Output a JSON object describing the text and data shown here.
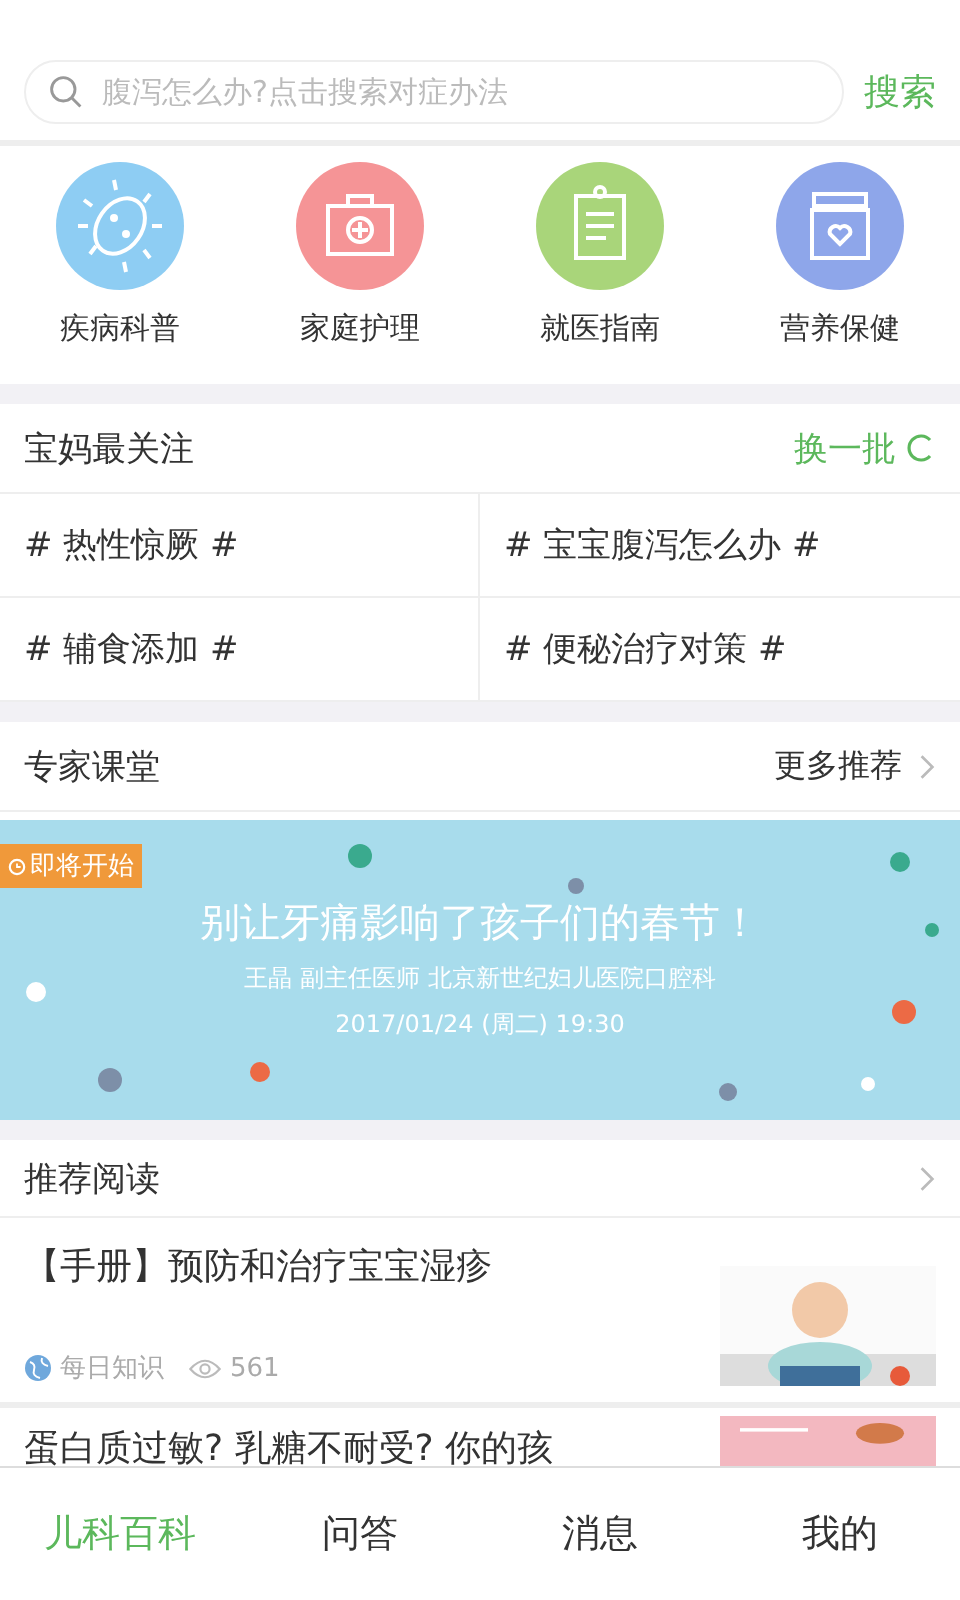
{
  "search": {
    "placeholder": "腹泻怎么办?点击搜索对症办法",
    "button": "搜索"
  },
  "categories": [
    {
      "label": "疾病科普",
      "kind": "germ",
      "color": "#8ecdf3"
    },
    {
      "label": "家庭护理",
      "kind": "kit",
      "color": "#f59496"
    },
    {
      "label": "就医指南",
      "kind": "clipboard",
      "color": "#a9d57a"
    },
    {
      "label": "营养保健",
      "kind": "jar",
      "color": "#8ea6ea"
    }
  ],
  "hot": {
    "title": "宝妈最关注",
    "refresh": "换一批",
    "topics": [
      "# 热性惊厥 #",
      "# 宝宝腹泻怎么办 #",
      "# 辅食添加 #",
      "# 便秘治疗对策 #"
    ]
  },
  "experts": {
    "title": "专家课堂",
    "more": "更多推荐",
    "banner": {
      "badge": "即将开始",
      "headline": "别让牙痛影响了孩子们的春节！",
      "speaker": "王晶 副主任医师 北京新世纪妇儿医院口腔科",
      "time": "2017/01/24 (周二) 19:30"
    }
  },
  "reading": {
    "title": "推荐阅读",
    "articles": [
      {
        "title": "【手册】预防和治疗宝宝湿疹",
        "source": "每日知识",
        "views": "561",
        "kind": "picture"
      },
      {
        "title": "蛋白质过敏? 乳糖不耐受? 你的孩",
        "kind": "picture"
      }
    ]
  },
  "tabs": [
    {
      "label": "儿科百科",
      "selected": true
    },
    {
      "label": "问答",
      "selected": false
    },
    {
      "label": "消息",
      "selected": false
    },
    {
      "label": "我的",
      "selected": false
    }
  ]
}
